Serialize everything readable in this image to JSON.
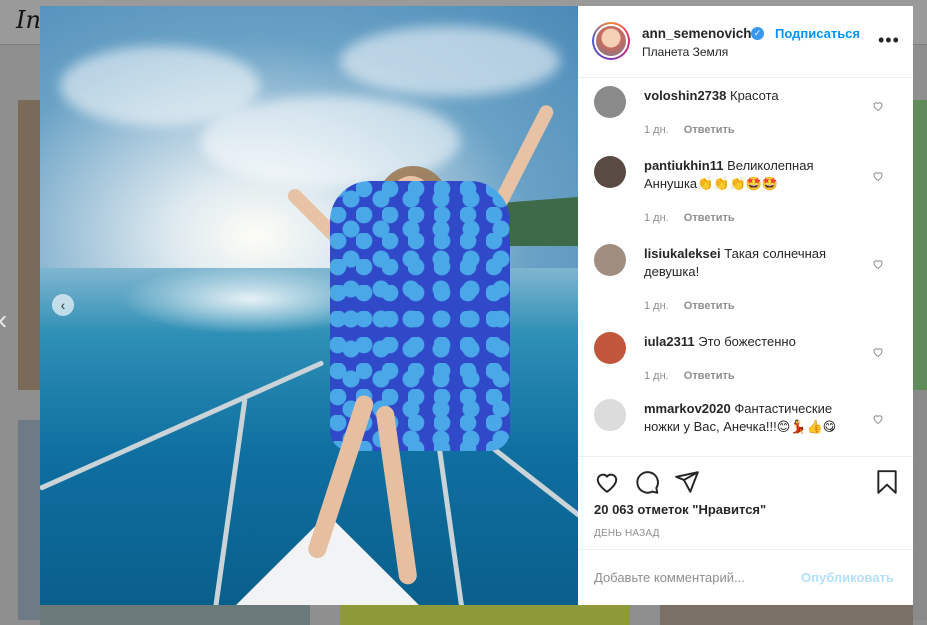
{
  "background": {
    "logo_text": "In"
  },
  "post": {
    "username": "ann_semenovich",
    "follow_label": "Подписаться",
    "location": "Планета Земля",
    "more_label": "•••"
  },
  "comments": [
    {
      "user": "voloshin2738",
      "text": "Красота",
      "age": "1 дн.",
      "reply": "Ответить",
      "avatar_color": "#8a8a8a"
    },
    {
      "user": "pantiukhin11",
      "text": "Великолепная Аннушка👏👏👏🤩🤩",
      "age": "1 дн.",
      "reply": "Ответить",
      "avatar_color": "#5a4a44"
    },
    {
      "user": "lisiukaleksei",
      "text": "Такая солнечная девушка!",
      "age": "1 дн.",
      "reply": "Ответить",
      "avatar_color": "#a08f80"
    },
    {
      "user": "iula2311",
      "text": "Это божестенно",
      "age": "1 дн.",
      "reply": "Ответить",
      "avatar_color": "#c0563b"
    },
    {
      "user": "mmarkov2020",
      "text": "Фантастические ножки у Вас, Анечка!!!😊💃👍😋",
      "age": "",
      "reply": "",
      "avatar_color": "#dcdcdc"
    }
  ],
  "likes_text": "20 063 отметок \"Нравится\"",
  "date_text": "ДЕНЬ НАЗАД",
  "comment_input": {
    "placeholder": "Добавьте комментарий...",
    "value": ""
  },
  "publish_label": "Опубликовать",
  "colors": {
    "accent": "#0095f6",
    "publish_disabled": "#b2dffc",
    "muted": "#8e8e8e",
    "verified": "#3897f0"
  },
  "icons": {
    "carousel_prev": "chevron-left-icon",
    "like": "heart-icon",
    "comment": "comment-icon",
    "share": "paper-plane-icon",
    "save": "bookmark-icon"
  }
}
